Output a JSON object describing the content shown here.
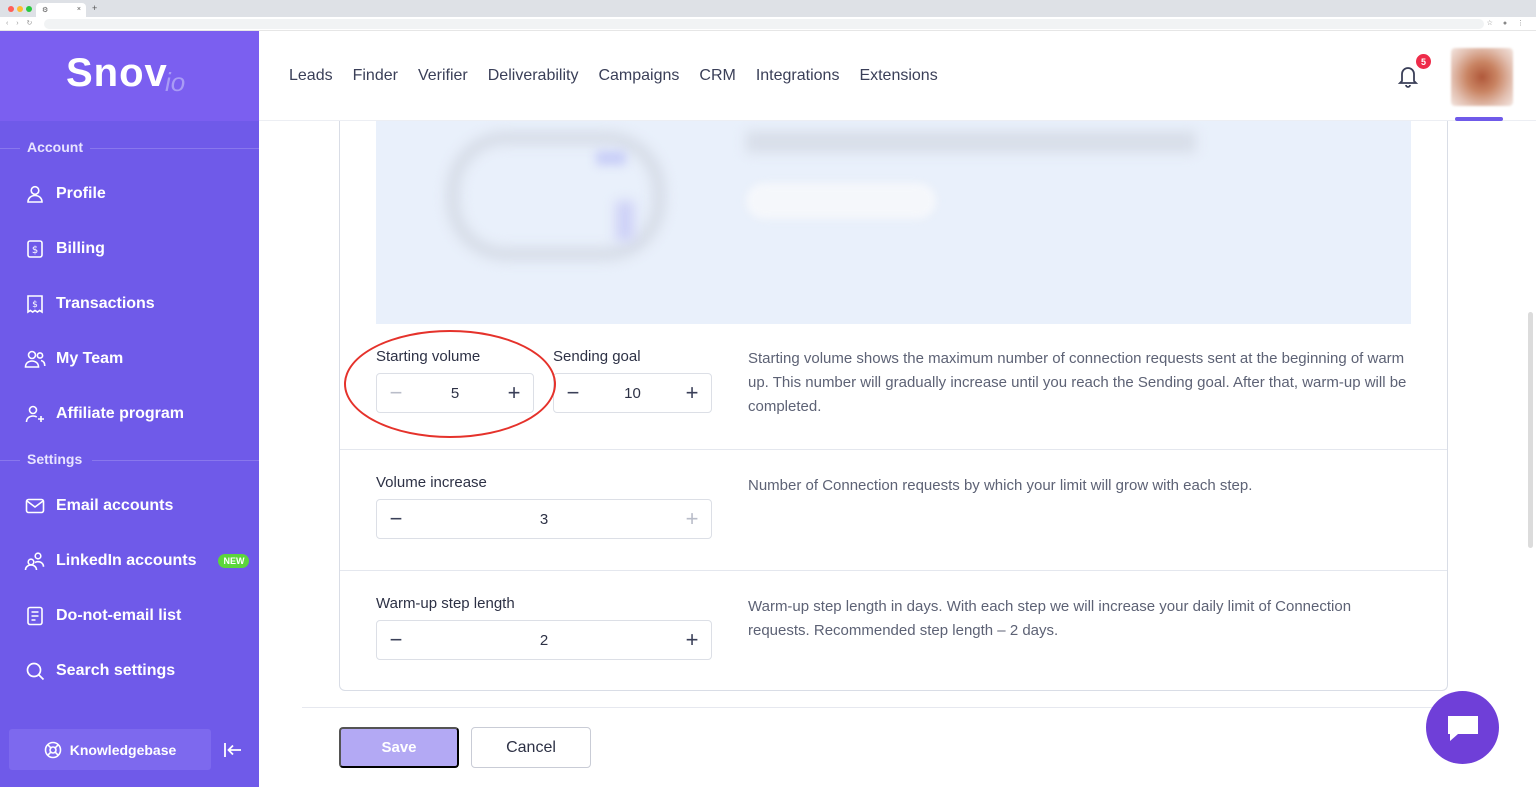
{
  "browser": {
    "tab_title": "",
    "tab_close": "×",
    "new_tab": "+"
  },
  "sidebar": {
    "logo_main": "Snov",
    "logo_suffix": "io",
    "sections": [
      {
        "label": "Account",
        "items": [
          {
            "label": "Profile",
            "icon": "user-icon"
          },
          {
            "label": "Billing",
            "icon": "billing-icon"
          },
          {
            "label": "Transactions",
            "icon": "receipt-icon"
          },
          {
            "label": "My Team",
            "icon": "team-icon"
          },
          {
            "label": "Affiliate program",
            "icon": "add-user-icon"
          }
        ]
      },
      {
        "label": "Settings",
        "items": [
          {
            "label": "Email accounts",
            "icon": "mail-icon"
          },
          {
            "label": "LinkedIn accounts",
            "icon": "people-icon",
            "badge": "NEW"
          },
          {
            "label": "Do-not-email list",
            "icon": "document-icon"
          },
          {
            "label": "Search settings",
            "icon": "search-icon"
          }
        ]
      }
    ],
    "knowledgebase_label": "Knowledgebase"
  },
  "topnav": {
    "items": [
      "Leads",
      "Finder",
      "Verifier",
      "Deliverability",
      "Campaigns",
      "CRM",
      "Integrations",
      "Extensions"
    ],
    "notification_count": "5"
  },
  "settings": {
    "starting_volume": {
      "label": "Starting volume",
      "value": "5"
    },
    "sending_goal": {
      "label": "Sending goal",
      "value": "10"
    },
    "volume_desc": "Starting volume shows the maximum number of connection requests sent at the beginning of warm up. This number will gradually increase until you reach the Sending goal. After that, warm-up will be completed.",
    "volume_increase": {
      "label": "Volume increase",
      "value": "3",
      "desc": "Number of Connection requests by which your limit will grow with each step."
    },
    "step_length": {
      "label": "Warm-up step length",
      "value": "2",
      "desc": "Warm-up step length in days. With each step we will increase your daily limit of Connection requests. Recommended step length – 2 days."
    },
    "minus": "−",
    "plus": "+"
  },
  "footer": {
    "save_label": "Save",
    "cancel_label": "Cancel"
  },
  "colors": {
    "sidebar": "#6f5ae9",
    "accent": "#7b5ff0",
    "annotation": "#e5322b",
    "badge_new": "#5bd63b"
  }
}
